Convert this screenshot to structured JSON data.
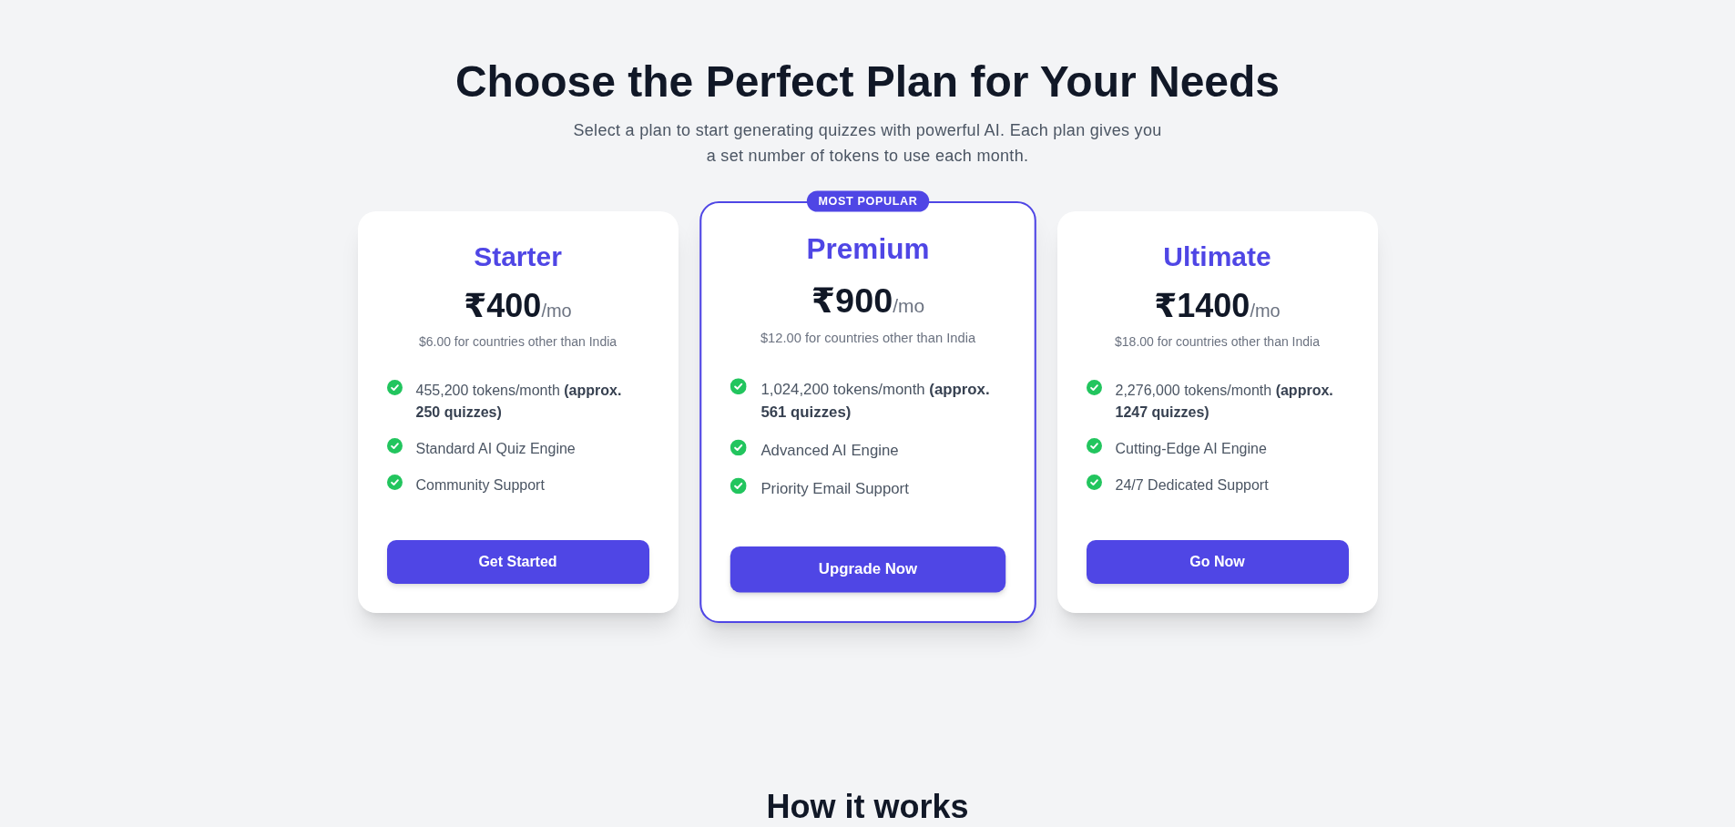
{
  "heading": {
    "title": "Choose the Perfect Plan for Your Needs",
    "subtitle": "Select a plan to start generating quizzes with powerful AI. Each plan gives you a set number of tokens to use each month."
  },
  "plans": [
    {
      "name": "Starter",
      "featured": false,
      "price": "₹400",
      "period": "/mo",
      "alt_price": "$6.00 for countries other than India",
      "features": [
        "455,200 tokens/month **(approx. 250 quizzes)**",
        "Standard AI Quiz Engine",
        "Community Support"
      ],
      "button": "Get Started"
    },
    {
      "name": "Premium",
      "featured": true,
      "badge": "MOST POPULAR",
      "price": "₹900",
      "period": "/mo",
      "alt_price": "$12.00 for countries other than India",
      "features": [
        "1,024,200 tokens/month **(approx. 561 quizzes)**",
        "Advanced AI Engine",
        "Priority Email Support"
      ],
      "button": "Upgrade Now"
    },
    {
      "name": "Ultimate",
      "featured": false,
      "price": "₹1400",
      "period": "/mo",
      "alt_price": "$18.00 for countries other than India",
      "features": [
        "2,276,000 tokens/month **(approx. 1247 quizzes)**",
        "Cutting-Edge AI Engine",
        "24/7 Dedicated Support"
      ],
      "button": "Go Now"
    }
  ],
  "next_section": {
    "title": "How it works"
  }
}
